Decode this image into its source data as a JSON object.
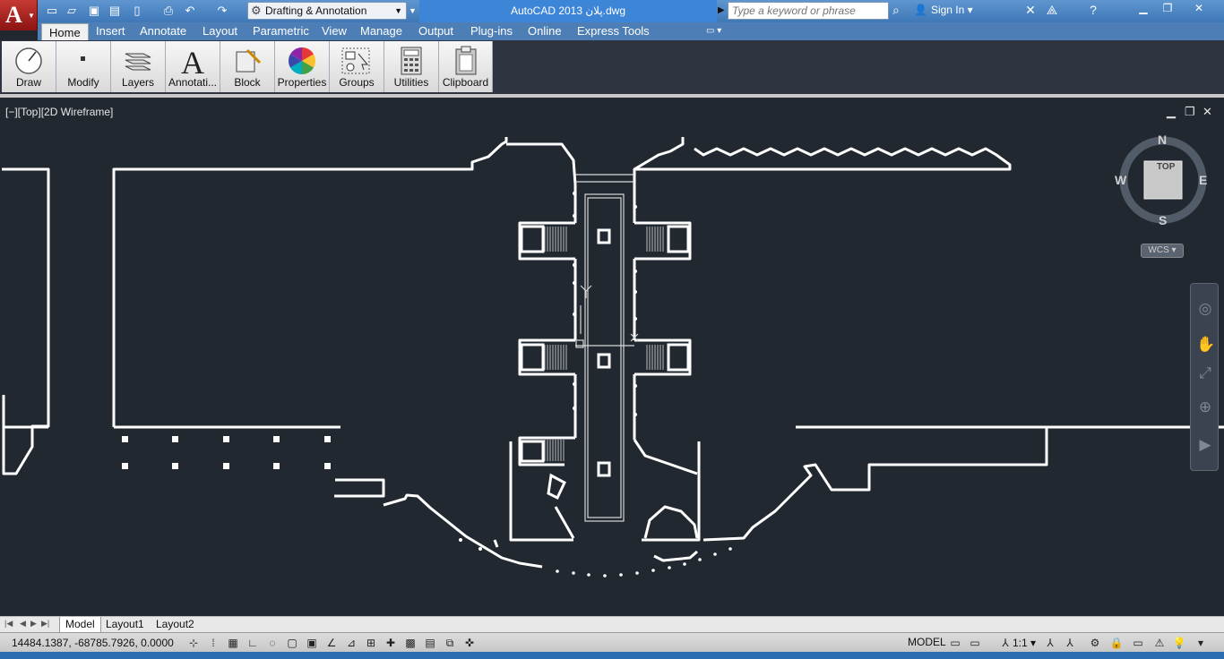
{
  "window": {
    "title": "AutoCAD 2013   پلان.dwg",
    "workspace": "Drafting & Annotation",
    "search_placeholder": "Type a keyword or phrase",
    "sign_in": "Sign In"
  },
  "icons": {
    "quick_access": [
      "new-icon",
      "open-icon",
      "save-icon",
      "saveas-icon",
      "plot-preview-icon",
      "print-icon",
      "undo-icon",
      "redo-icon"
    ],
    "title_tools": [
      "search-icon",
      "user-icon",
      "exchange-icon",
      "autodesk-360-icon",
      "help-icon"
    ],
    "window_controls": [
      "minimize-icon",
      "restore-icon",
      "close-icon"
    ]
  },
  "ribbon": {
    "tabs": [
      "Home",
      "Insert",
      "Annotate",
      "Layout",
      "Parametric",
      "View",
      "Manage",
      "Output",
      "Plug-ins",
      "Online",
      "Express Tools"
    ],
    "active_tab": "Home",
    "panels": [
      "Draw",
      "Modify",
      "Layers",
      "Annotati...",
      "Block",
      "Properties",
      "Groups",
      "Utilities",
      "Clipboard"
    ]
  },
  "viewport": {
    "label": "[−][Top][2D Wireframe]",
    "viewcube": {
      "face": "TOP",
      "north": "N",
      "south": "S",
      "east": "E",
      "west": "W",
      "ucs": "WCS"
    },
    "nav_tools": [
      "steering-wheel-icon",
      "pan-icon",
      "zoom-icon",
      "orbit-icon",
      "showmotion-icon"
    ]
  },
  "layout_tabs": [
    "Model",
    "Layout1",
    "Layout2"
  ],
  "active_layout": "Model",
  "status": {
    "coordinates": "14484.1387,  -68785.7926, 0.0000",
    "space": "MODEL",
    "annotation_scale": "1:1"
  },
  "colors": {
    "canvas": "#212830",
    "title_active": "#3d85d7",
    "ribbon_tab_bar": "#4d7fb6",
    "app_button": "#c73a33"
  }
}
